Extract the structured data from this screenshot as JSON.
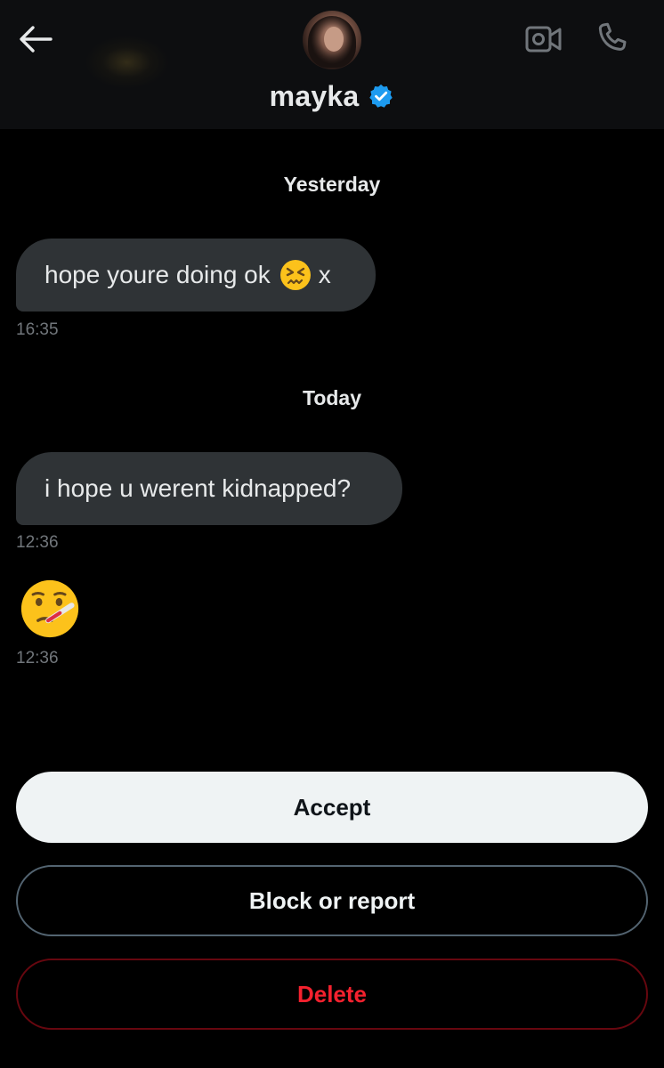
{
  "header": {
    "name": "mayka",
    "verified_color": "#1d9bf0",
    "icons": [
      "back-arrow-icon",
      "avatar",
      "verified-badge-icon",
      "video-call-icon",
      "phone-icon"
    ]
  },
  "conversation": {
    "groups": [
      {
        "day": "Yesterday",
        "messages": [
          {
            "text_before": "hope youre doing ok",
            "emoji": "confounded-face-emoji",
            "text_after": "x",
            "time": "16:35"
          }
        ]
      },
      {
        "day": "Today",
        "messages": [
          {
            "text": "i hope u werent kidnapped?",
            "time": "12:36"
          },
          {
            "emoji": "face-with-thermometer-emoji",
            "time": "12:36"
          }
        ]
      }
    ]
  },
  "actions": {
    "accept_label": "Accept",
    "block_label": "Block or report",
    "delete_label": "Delete"
  },
  "colors": {
    "background": "#000000",
    "header_bg": "#0d0e10",
    "bubble_bg": "#2f3336",
    "timestamp": "#71767b",
    "accept_bg": "#eff3f4",
    "delete_text": "#f4212e",
    "delete_border": "#67070f"
  }
}
